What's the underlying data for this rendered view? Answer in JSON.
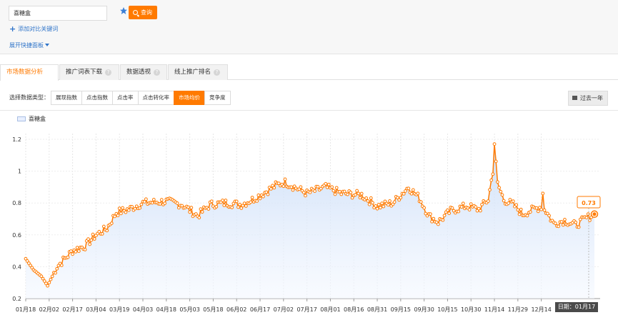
{
  "search": {
    "value": "喜糖盒",
    "button": "查询"
  },
  "add_compare": "添加对比关键词",
  "expand_panel": "展开快捷面板",
  "tabs": [
    {
      "label": "市场数据分析",
      "active": true,
      "help": false
    },
    {
      "label": "推广词表下载",
      "active": false,
      "help": true
    },
    {
      "label": "数据透视",
      "active": false,
      "help": true
    },
    {
      "label": "线上推广排名",
      "active": false,
      "help": true
    }
  ],
  "type_selector": {
    "label": "选择数据类型：",
    "options": [
      "展现指数",
      "点击指数",
      "点击率",
      "点击转化率",
      "市场均价",
      "竞争度"
    ],
    "selected": "市场均价"
  },
  "period_button": "过去一年",
  "colors": {
    "accent": "#ff7a00",
    "link": "#2f74c9",
    "area": "#e8efff"
  },
  "chart_data": {
    "type": "line",
    "series": [
      {
        "name": "喜糖盒"
      }
    ],
    "y_ticks": [
      "0.2",
      "0.4",
      "0.6",
      "0.8",
      "1",
      "1.2"
    ],
    "ylim": [
      0.2,
      1.2
    ],
    "x_tick_labels": [
      "01月18",
      "02月02",
      "02月17",
      "03月04",
      "03月19",
      "04月03",
      "04月18",
      "05月03",
      "05月18",
      "06月02",
      "06月17",
      "07月02",
      "07月17",
      "08月01",
      "08月16",
      "08月31",
      "09月15",
      "09月30",
      "10月15",
      "10月30",
      "11月14",
      "11月29",
      "12月14"
    ],
    "x_tick_day_index": [
      0,
      15,
      30,
      45,
      60,
      75,
      90,
      105,
      120,
      135,
      150,
      165,
      180,
      195,
      210,
      225,
      240,
      255,
      270,
      285,
      300,
      315,
      330
    ],
    "total_days": 365,
    "keypoints": [
      [
        0,
        0.45
      ],
      [
        5,
        0.38
      ],
      [
        10,
        0.34
      ],
      [
        14,
        0.28
      ],
      [
        20,
        0.4
      ],
      [
        30,
        0.5
      ],
      [
        38,
        0.53
      ],
      [
        45,
        0.6
      ],
      [
        52,
        0.64
      ],
      [
        58,
        0.74
      ],
      [
        66,
        0.76
      ],
      [
        75,
        0.8
      ],
      [
        90,
        0.81
      ],
      [
        100,
        0.79
      ],
      [
        110,
        0.72
      ],
      [
        118,
        0.79
      ],
      [
        128,
        0.8
      ],
      [
        138,
        0.79
      ],
      [
        145,
        0.82
      ],
      [
        152,
        0.86
      ],
      [
        160,
        0.91
      ],
      [
        166,
        0.93
      ],
      [
        172,
        0.9
      ],
      [
        180,
        0.86
      ],
      [
        192,
        0.9
      ],
      [
        202,
        0.86
      ],
      [
        215,
        0.85
      ],
      [
        225,
        0.78
      ],
      [
        235,
        0.8
      ],
      [
        245,
        0.9
      ],
      [
        252,
        0.83
      ],
      [
        258,
        0.72
      ],
      [
        264,
        0.68
      ],
      [
        272,
        0.75
      ],
      [
        282,
        0.78
      ],
      [
        290,
        0.76
      ],
      [
        296,
        0.82
      ],
      [
        299,
        1.0
      ],
      [
        300,
        1.17
      ],
      [
        302,
        0.92
      ],
      [
        306,
        0.82
      ],
      [
        312,
        0.79
      ],
      [
        318,
        0.73
      ],
      [
        325,
        0.76
      ],
      [
        331,
        0.78
      ],
      [
        338,
        0.67
      ],
      [
        345,
        0.69
      ],
      [
        352,
        0.66
      ],
      [
        358,
        0.7
      ],
      [
        364,
        0.73
      ]
    ],
    "spikes": [
      [
        300,
        1.17
      ],
      [
        331,
        0.86
      ]
    ],
    "last_value_label": "0.73",
    "date_label": "日期：01月17"
  }
}
